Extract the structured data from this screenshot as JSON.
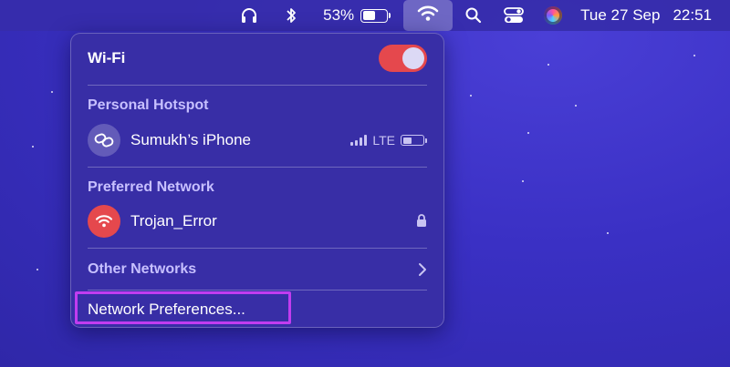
{
  "menubar": {
    "battery_percent": "53%",
    "battery_level": 0.53,
    "date": "Tue 27 Sep",
    "time": "22:51",
    "icons": [
      "headphones-icon",
      "bluetooth-icon",
      "battery-icon",
      "wifi-icon",
      "search-icon",
      "control-center-icon",
      "siri-icon"
    ]
  },
  "wifi_menu": {
    "title": "Wi-Fi",
    "wifi_enabled": true,
    "hotspot": {
      "section_label": "Personal Hotspot",
      "device_name": "Sumukh’s iPhone",
      "network_type": "LTE",
      "battery_level": 0.45
    },
    "preferred": {
      "section_label": "Preferred Network",
      "network_name": "Trojan_Error",
      "secured": true
    },
    "other_networks_label": "Other Networks",
    "network_preferences_label": "Network Preferences..."
  },
  "colors": {
    "accent_toggle": "#e5484d",
    "highlight_outline": "#c13cf0",
    "background": "#3a30c4"
  }
}
